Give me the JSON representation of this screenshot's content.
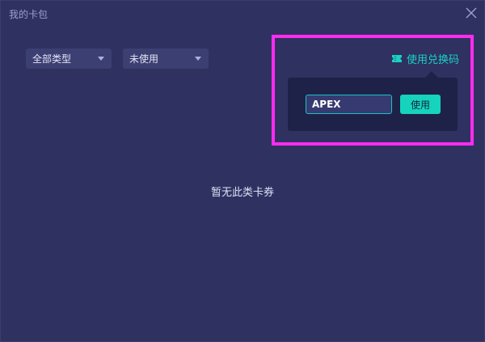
{
  "window": {
    "title": "我的卡包",
    "close_icon": "close-icon"
  },
  "filters": {
    "type_select": {
      "value": "全部类型"
    },
    "status_select": {
      "value": "未使用"
    }
  },
  "redeem": {
    "link_label": "使用兑换码",
    "link_icon": "ticket-icon",
    "code_value": "APEX",
    "use_button_label": "使用",
    "accent_color": "#19d2c0",
    "highlight_color": "#ff2bf0"
  },
  "main": {
    "empty_message": "暂无此类卡券"
  }
}
